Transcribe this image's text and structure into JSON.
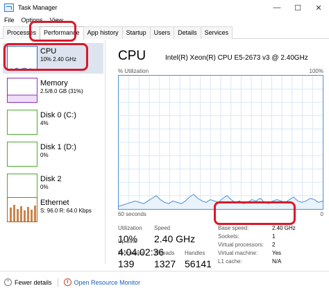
{
  "window": {
    "title": "Task Manager",
    "min": "—",
    "max": "☐",
    "close": "✕"
  },
  "menu": [
    "File",
    "Options",
    "View"
  ],
  "tabs": [
    "Processes",
    "Performance",
    "App history",
    "Startup",
    "Users",
    "Details",
    "Services"
  ],
  "sidebar": {
    "items": [
      {
        "name": "CPU",
        "sub": "10% 2.40 GHz",
        "color": "#1e6fc7"
      },
      {
        "name": "Memory",
        "sub": "2.5/8.0 GB (31%)",
        "color": "#8b2fb3"
      },
      {
        "name": "Disk 0 (C:)",
        "sub": "4%",
        "color": "#4caa2f"
      },
      {
        "name": "Disk 1 (D:)",
        "sub": "0%",
        "color": "#4caa2f"
      },
      {
        "name": "Disk 2",
        "sub": "0%",
        "color": "#4caa2f"
      },
      {
        "name": "Ethernet",
        "sub": "S: 96.0  R: 64.0 Kbps",
        "color": "#b3621c"
      }
    ]
  },
  "main": {
    "title": "CPU",
    "model": "Intel(R) Xeon(R) CPU E5-2673 v3 @ 2.40GHz",
    "util_label": "% Utilization",
    "util_max": "100%",
    "time_label": "60 seconds",
    "min_label": "0",
    "utilization_series": [
      2,
      3,
      4,
      5,
      6,
      5,
      4,
      6,
      8,
      10,
      7,
      5,
      4,
      6,
      5,
      4,
      6,
      9,
      11,
      8,
      6,
      5,
      7,
      6,
      5,
      8,
      10,
      7,
      5,
      6,
      4,
      5,
      7,
      6,
      8,
      5,
      4,
      6,
      7,
      6,
      5,
      7,
      9,
      6,
      5,
      6,
      8,
      7,
      5,
      6
    ],
    "stats": {
      "utilization_label": "Utilization",
      "utilization": "10%",
      "speed_label": "Speed",
      "speed": "2.40 GHz",
      "processes_label": "Processes",
      "processes": "139",
      "threads_label": "Threads",
      "threads": "1327",
      "handles_label": "Handles",
      "handles": "56141",
      "uptime_label": "Up time",
      "uptime": "4:04:02:36"
    },
    "details": [
      {
        "label": "Base speed:",
        "value": "2.40 GHz"
      },
      {
        "label": "Sockets:",
        "value": "1"
      },
      {
        "label": "Virtual processors:",
        "value": "2"
      },
      {
        "label": "Virtual machine:",
        "value": "Yes"
      },
      {
        "label": "L1 cache:",
        "value": "N/A"
      }
    ]
  },
  "footer": {
    "fewer": "Fewer details",
    "monitor": "Open Resource Monitor"
  },
  "colors": {
    "highlight": "#d8192a",
    "graph_line": "#4a8fd3",
    "graph_grid": "#d9e7f6"
  }
}
